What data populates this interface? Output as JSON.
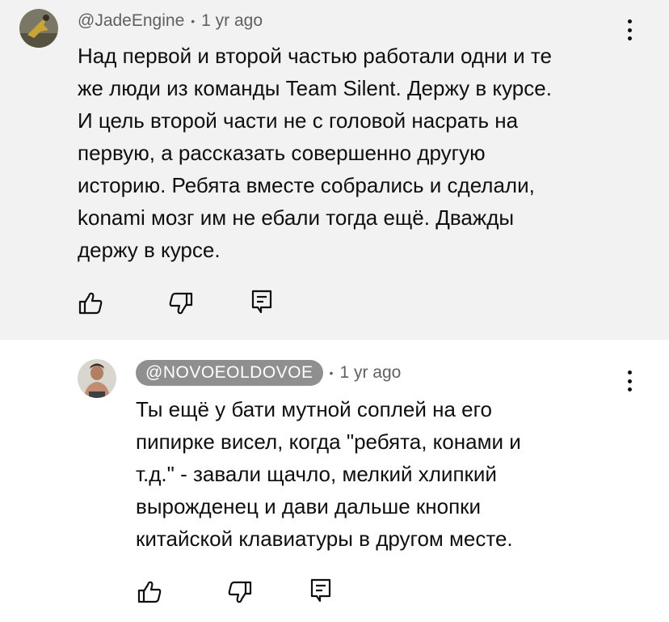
{
  "comments": [
    {
      "author": "@JadeEngine",
      "separator": "•",
      "time": "1 yr ago",
      "lines": [
        "Над первой и второй частью работали одни и те",
        "же люди из команды Team Silent. Держу в курсе.",
        "И цель второй части не с головой насрать на",
        "первую, а рассказать совершенно другую",
        "историю. Ребята вместе собрались и сделали,",
        "konami мозг им не ебали тогда ещё. Дважды",
        "держу в курсе."
      ]
    },
    {
      "author": "@NOVOEOLDOVOE",
      "separator": "•",
      "time": "1 yr ago",
      "lines": [
        "Ты ещё у бати мутной соплей на его",
        "пипирке висел, когда \"ребята, конами и",
        "т.д.\" - завали щачло, мелкий хлипкий",
        "вырожденец и дави дальше кнопки",
        "китайской клавиатуры в другом месте."
      ]
    }
  ],
  "icons": {
    "like": "thumbs-up-icon",
    "dislike": "thumbs-down-icon",
    "reply": "reply-comment-icon",
    "more": "more-vertical-icon"
  },
  "colors": {
    "highlight_bg": "#f2f2f2",
    "meta_text": "#606060",
    "handle_pill": "#8f8f8f"
  }
}
